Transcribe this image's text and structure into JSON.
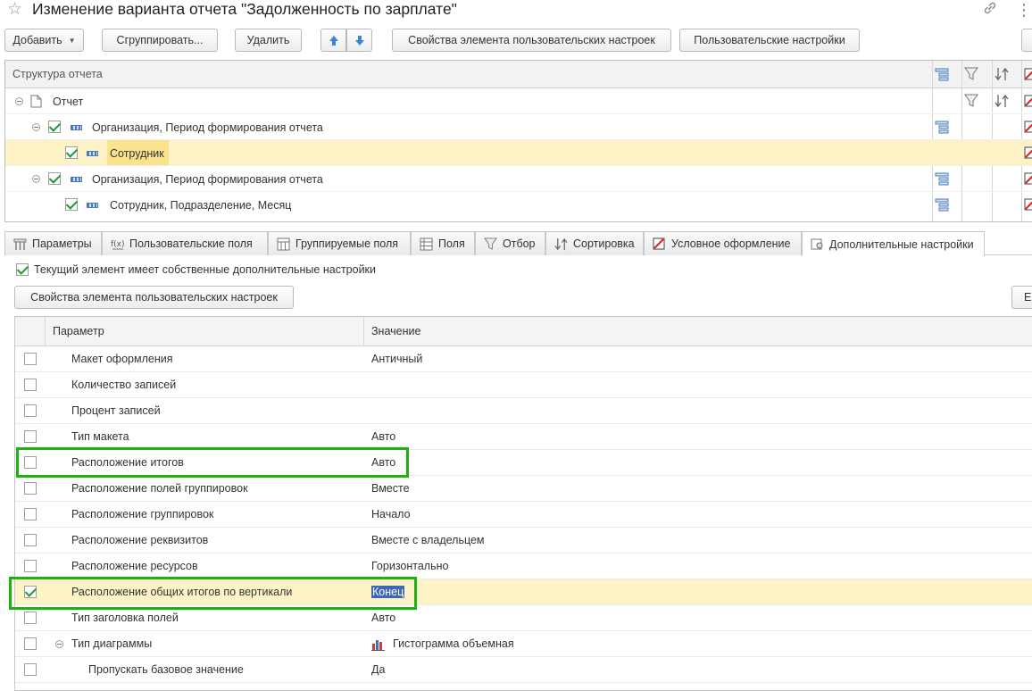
{
  "window": {
    "title": "Изменение варианта отчета \"Задолженность по зарплате\""
  },
  "toolbar": {
    "add_label": "Добавить",
    "group_label": "Сгруппировать...",
    "delete_label": "Удалить",
    "element_props_label": "Свойства элемента пользовательских настроек",
    "user_settings_label": "Пользовательские настройки"
  },
  "structure": {
    "header": "Структура отчета",
    "rows": [
      {
        "label": "Отчет",
        "checked": null
      },
      {
        "label": "Организация, Период формирования отчета",
        "checked": true
      },
      {
        "label": "Сотрудник",
        "checked": true,
        "selected": true
      },
      {
        "label": "Организация, Период формирования отчета",
        "checked": true
      },
      {
        "label": "Сотрудник, Подразделение, Месяц",
        "checked": true
      }
    ]
  },
  "tabs": [
    {
      "label": "Параметры"
    },
    {
      "label": "Пользовательские поля"
    },
    {
      "label": "Группируемые поля"
    },
    {
      "label": "Поля"
    },
    {
      "label": "Отбор"
    },
    {
      "label": "Сортировка"
    },
    {
      "label": "Условное оформление"
    },
    {
      "label": "Дополнительные настройки",
      "active": true
    }
  ],
  "settings": {
    "own_settings_label": "Текущий элемент имеет собственные дополнительные настройки",
    "own_settings_checked": true,
    "props_button_label": "Свойства элемента пользовательских настроек",
    "right_button_label": "Е"
  },
  "params_table": {
    "col_param": "Параметр",
    "col_value": "Значение",
    "rows": [
      {
        "param": "Макет оформления",
        "value": "Античный",
        "checked": false
      },
      {
        "param": "Количество записей",
        "value": "",
        "checked": false
      },
      {
        "param": "Процент записей",
        "value": "",
        "checked": false
      },
      {
        "param": "Тип макета",
        "value": "Авто",
        "checked": false
      },
      {
        "param": "Расположение итогов",
        "value": "Авто",
        "checked": false
      },
      {
        "param": "Расположение полей группировок",
        "value": "Вместе",
        "checked": false
      },
      {
        "param": "Расположение группировок",
        "value": "Начало",
        "checked": false
      },
      {
        "param": "Расположение реквизитов",
        "value": "Вместе с владельцем",
        "checked": false
      },
      {
        "param": "Расположение ресурсов",
        "value": "Горизонтально",
        "checked": false
      },
      {
        "param": "Расположение общих итогов по вертикали",
        "value": "Конец",
        "checked": true,
        "selected": true
      },
      {
        "param": "Тип заголовка полей",
        "value": "Авто",
        "checked": false
      },
      {
        "param": "Тип диаграммы",
        "value": "Гистограмма объемная",
        "checked": false
      },
      {
        "param": "Пропускать базовое значение",
        "value": "Да",
        "checked": false
      }
    ]
  },
  "colors": {
    "highlight_border": "#1fb013",
    "selected_row": "#fdf3c6",
    "check_green": "#1f9a39",
    "value_selection": "#3f67b8"
  }
}
